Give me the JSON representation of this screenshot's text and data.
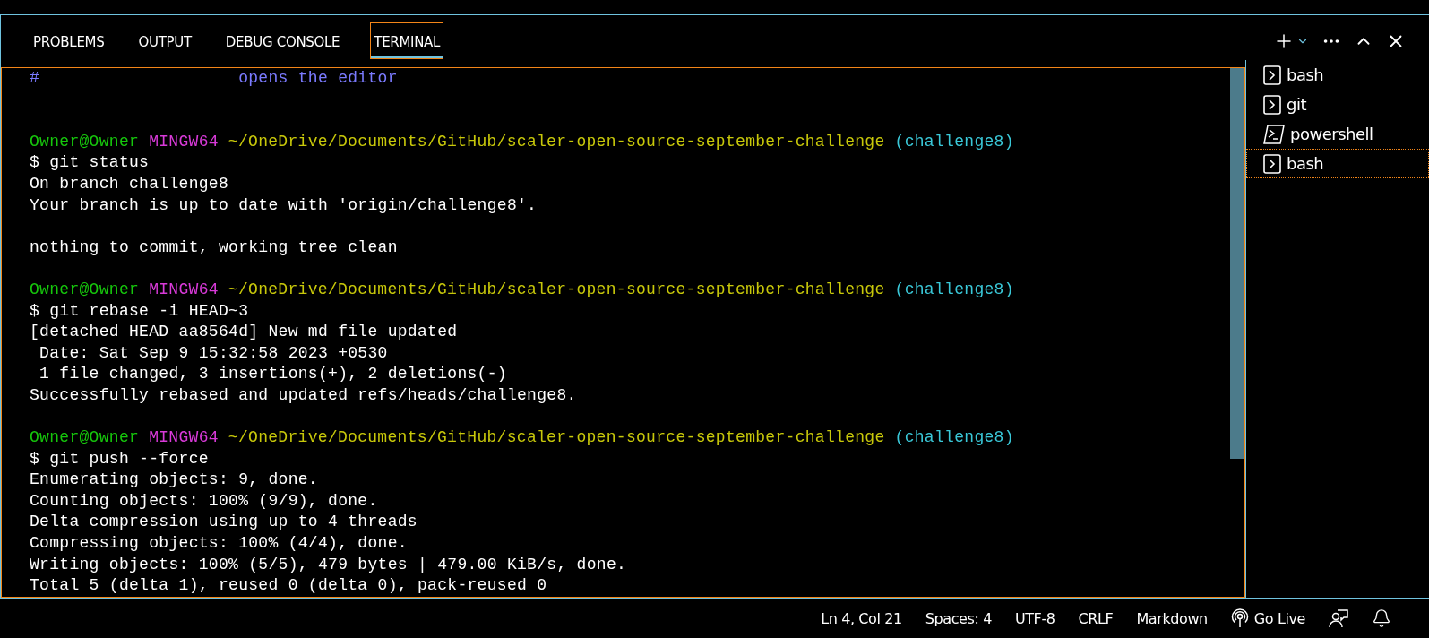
{
  "panel_tabs": [
    {
      "label": "PROBLEMS",
      "selected": false
    },
    {
      "label": "OUTPUT",
      "selected": false
    },
    {
      "label": "DEBUG CONSOLE",
      "selected": false
    },
    {
      "label": "TERMINAL",
      "selected": true
    }
  ],
  "terminal": {
    "lines": [
      {
        "kind": "text",
        "segments": [
          {
            "kind": "comment",
            "text": "#                    opens the editor"
          }
        ]
      },
      {
        "kind": "blank"
      },
      {
        "kind": "blank"
      },
      {
        "kind": "text",
        "segments": [
          {
            "kind": "user",
            "text": "Owner@Owner"
          },
          {
            "kind": "host",
            "text": "MINGW64"
          },
          {
            "kind": "path",
            "text": "~/OneDrive/Documents/GitHub/scaler-open-source-september-challenge"
          },
          {
            "kind": "branch",
            "text": "(challenge8)"
          }
        ]
      },
      {
        "kind": "text",
        "segments": [
          {
            "kind": "output",
            "text": "$ git status"
          }
        ]
      },
      {
        "kind": "text",
        "segments": [
          {
            "kind": "output",
            "text": "On branch challenge8"
          }
        ]
      },
      {
        "kind": "text",
        "segments": [
          {
            "kind": "output",
            "text": "Your branch is up to date with 'origin/challenge8'."
          }
        ]
      },
      {
        "kind": "blank"
      },
      {
        "kind": "text",
        "segments": [
          {
            "kind": "output",
            "text": "nothing to commit, working tree clean"
          }
        ]
      },
      {
        "kind": "blank"
      },
      {
        "kind": "text",
        "segments": [
          {
            "kind": "user",
            "text": "Owner@Owner"
          },
          {
            "kind": "host",
            "text": "MINGW64"
          },
          {
            "kind": "path",
            "text": "~/OneDrive/Documents/GitHub/scaler-open-source-september-challenge"
          },
          {
            "kind": "branch",
            "text": "(challenge8)"
          }
        ]
      },
      {
        "kind": "text",
        "segments": [
          {
            "kind": "output",
            "text": "$ git rebase -i HEAD~3"
          }
        ]
      },
      {
        "kind": "text",
        "segments": [
          {
            "kind": "output",
            "text": "[detached HEAD aa8564d] New md file updated"
          }
        ]
      },
      {
        "kind": "text",
        "segments": [
          {
            "kind": "output",
            "text": " Date: Sat Sep 9 15:32:58 2023 +0530"
          }
        ]
      },
      {
        "kind": "text",
        "segments": [
          {
            "kind": "output",
            "text": " 1 file changed, 3 insertions(+), 2 deletions(-)"
          }
        ]
      },
      {
        "kind": "text",
        "segments": [
          {
            "kind": "output",
            "text": "Successfully rebased and updated refs/heads/challenge8."
          }
        ]
      },
      {
        "kind": "blank"
      },
      {
        "kind": "text",
        "segments": [
          {
            "kind": "user",
            "text": "Owner@Owner"
          },
          {
            "kind": "host",
            "text": "MINGW64"
          },
          {
            "kind": "path",
            "text": "~/OneDrive/Documents/GitHub/scaler-open-source-september-challenge"
          },
          {
            "kind": "branch",
            "text": "(challenge8)"
          }
        ]
      },
      {
        "kind": "text",
        "segments": [
          {
            "kind": "output",
            "text": "$ git push --force"
          }
        ]
      },
      {
        "kind": "text",
        "segments": [
          {
            "kind": "output",
            "text": "Enumerating objects: 9, done."
          }
        ]
      },
      {
        "kind": "text",
        "segments": [
          {
            "kind": "output",
            "text": "Counting objects: 100% (9/9), done."
          }
        ]
      },
      {
        "kind": "text",
        "segments": [
          {
            "kind": "output",
            "text": "Delta compression using up to 4 threads"
          }
        ]
      },
      {
        "kind": "text",
        "segments": [
          {
            "kind": "output",
            "text": "Compressing objects: 100% (4/4), done."
          }
        ]
      },
      {
        "kind": "text",
        "segments": [
          {
            "kind": "output",
            "text": "Writing objects: 100% (5/5), 479 bytes | 479.00 KiB/s, done."
          }
        ]
      },
      {
        "kind": "text",
        "segments": [
          {
            "kind": "output",
            "text": "Total 5 (delta 1), reused 0 (delta 0), pack-reused 0"
          }
        ]
      }
    ]
  },
  "terminal_list": [
    {
      "kind": "shell",
      "label": "bash",
      "selected": false
    },
    {
      "kind": "shell",
      "label": "git",
      "selected": false
    },
    {
      "kind": "powershell",
      "label": "powershell",
      "selected": false
    },
    {
      "kind": "shell",
      "label": "bash",
      "selected": true
    }
  ],
  "status_bar": [
    {
      "kind": "text",
      "label": "Ln 4, Col 21"
    },
    {
      "kind": "text",
      "label": "Spaces: 4"
    },
    {
      "kind": "text",
      "label": "UTF-8"
    },
    {
      "kind": "text",
      "label": "CRLF"
    },
    {
      "kind": "text",
      "label": "Markdown"
    },
    {
      "kind": "live",
      "label": "Go Live"
    },
    {
      "kind": "feedback"
    },
    {
      "kind": "bell"
    }
  ]
}
